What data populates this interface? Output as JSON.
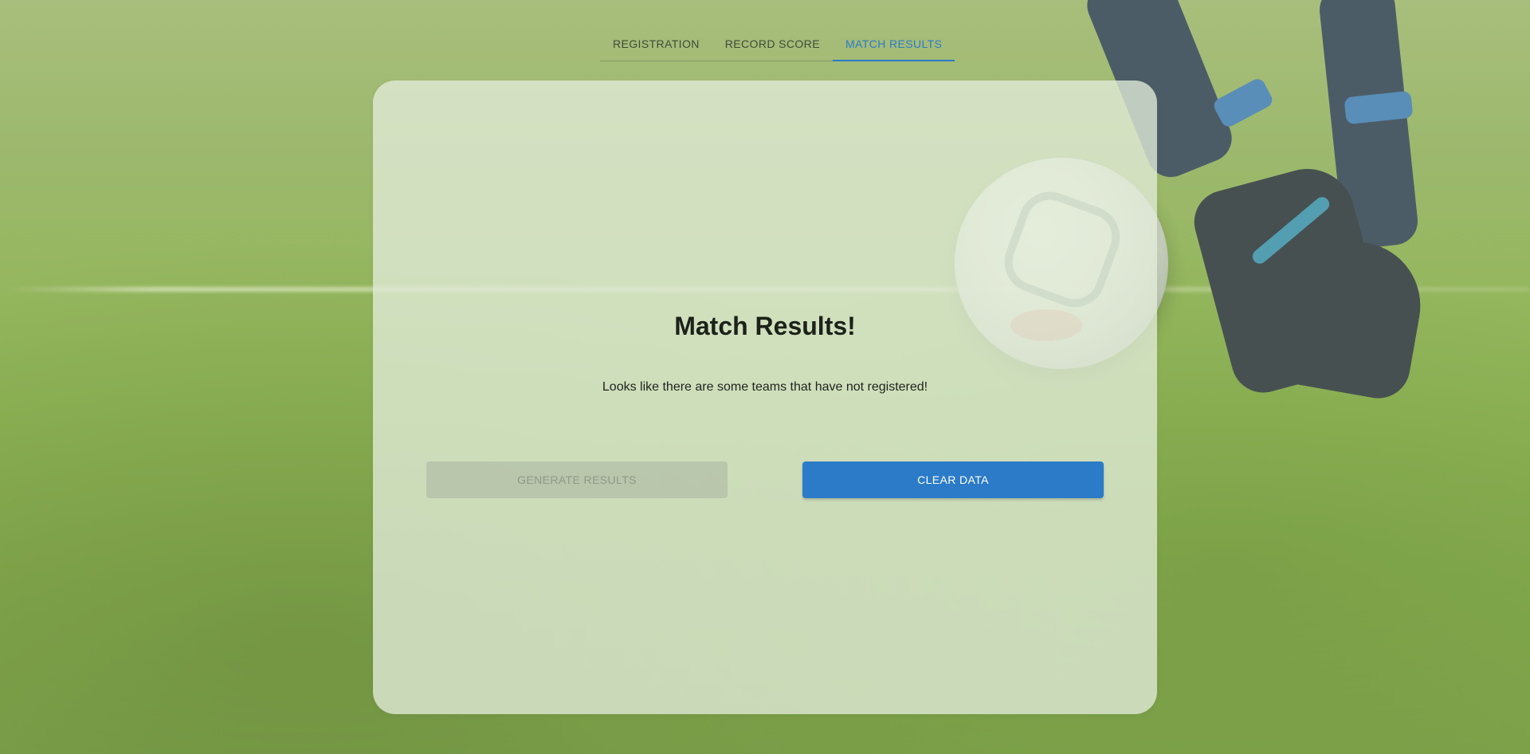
{
  "tabs": [
    {
      "label": "REGISTRATION",
      "active": false
    },
    {
      "label": "RECORD SCORE",
      "active": false
    },
    {
      "label": "MATCH RESULTS",
      "active": true
    }
  ],
  "card": {
    "title": "Match Results!",
    "message": "Looks like there are some teams that have not registered!",
    "buttons": {
      "generate": {
        "label": "GENERATE RESULTS",
        "disabled": true
      },
      "clear": {
        "label": "CLEAR DATA",
        "disabled": false
      }
    }
  },
  "colors": {
    "accent": "#2b7bc8",
    "card_background": "#e2ecd8",
    "field_green": "#7ea93c"
  }
}
